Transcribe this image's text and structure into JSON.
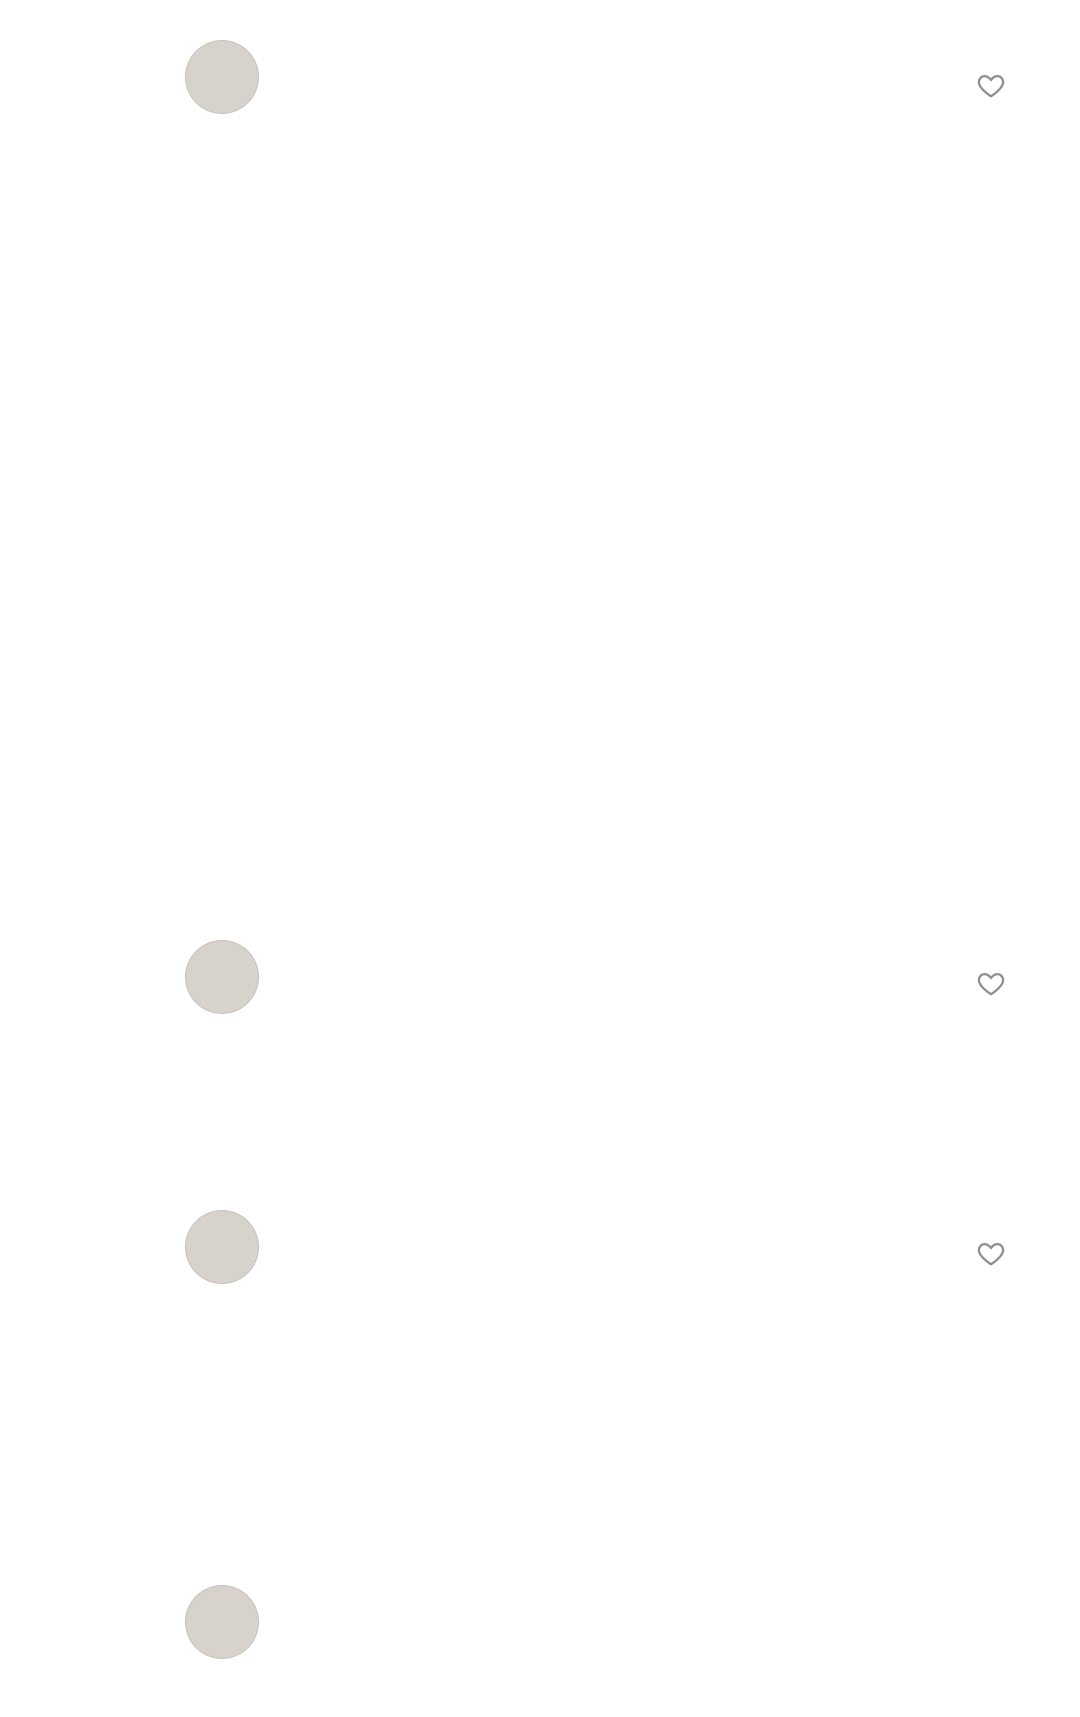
{
  "icons": {
    "like": "heart-outline-icon"
  },
  "comments": [
    {
      "username": "",
      "mention": "",
      "text": "",
      "time": "",
      "likes": "",
      "reply": ""
    },
    {
      "username": "",
      "mention": "",
      "text": "",
      "time": "",
      "likes": "",
      "reply": ""
    },
    {
      "username": "",
      "mention": "",
      "text": "",
      "time": "",
      "likes": "",
      "reply": ""
    },
    {
      "username": "",
      "mention": "",
      "text": "",
      "time": "",
      "likes": "",
      "reply": ""
    }
  ]
}
